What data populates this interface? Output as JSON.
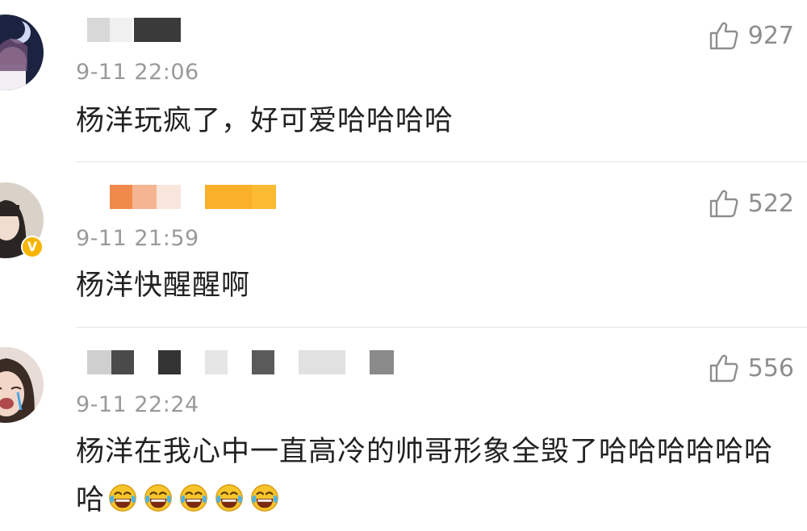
{
  "comments": [
    {
      "time": "9-11 22:06",
      "likes": "927",
      "text": "杨洋玩疯了，好可爱哈哈哈哈",
      "verified": false
    },
    {
      "time": "9-11 21:59",
      "likes": "522",
      "text": "杨洋快醒醒啊",
      "verified": true
    },
    {
      "time": "9-11 22:24",
      "likes": "556",
      "text": "杨洋在我心中一直高冷的帅哥形象全毁了哈哈哈哈哈哈哈",
      "verified": false,
      "emoji": [
        "laughing-crying",
        "laughing-crying",
        "laughing-crying",
        "laughing-crying",
        "laughing-crying"
      ]
    }
  ],
  "badge_label": "V",
  "colors": {
    "text": "#222222",
    "meta": "#9a9a9a",
    "divider": "#e3e3e3",
    "verified": "#f7b500"
  },
  "icons": {
    "like": "thumbs-up-icon",
    "emoji": "laughing-crying-icon"
  }
}
